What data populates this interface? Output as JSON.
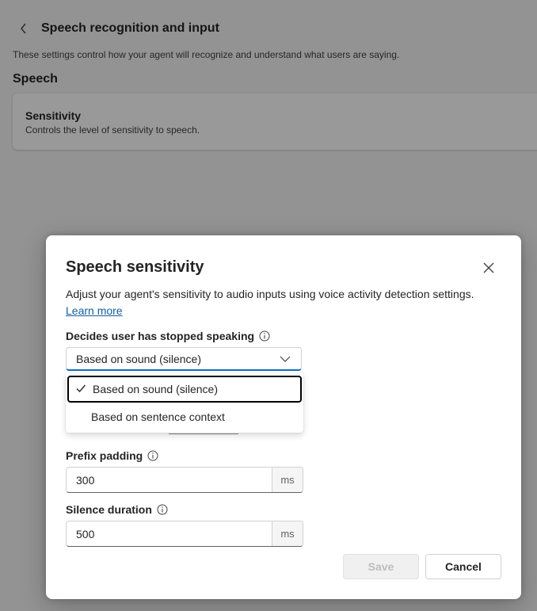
{
  "page": {
    "title": "Speech recognition and input",
    "description": "These settings control how your agent will recognize and understand what users are saying.",
    "section_title": "Speech",
    "card": {
      "title": "Sensitivity",
      "description": "Controls the level of sensitivity to speech."
    }
  },
  "dialog": {
    "title": "Speech sensitivity",
    "description": "Adjust your agent's sensitivity to audio inputs using voice activity detection settings.",
    "learn_more": "Learn more",
    "stop_speaking": {
      "label": "Decides user has stopped speaking",
      "value": "Based on sound (silence)",
      "options": [
        "Based on sound (silence)",
        "Based on sentence context"
      ],
      "selected_index": 0
    },
    "prefix_padding": {
      "label": "Prefix padding",
      "value": "300",
      "unit": "ms"
    },
    "silence_duration": {
      "label": "Silence duration",
      "value": "500",
      "unit": "ms"
    },
    "save_label": "Save",
    "cancel_label": "Cancel",
    "save_enabled": false
  },
  "icons": {
    "back": "chevron-left-icon",
    "close": "close-icon",
    "info": "info-icon",
    "chevron": "chevron-down-icon",
    "check": "checkmark-icon"
  },
  "colors": {
    "accent": "#0f6cbd",
    "link": "#115ea3",
    "overlay": "rgba(0,0,0,0.4)"
  }
}
